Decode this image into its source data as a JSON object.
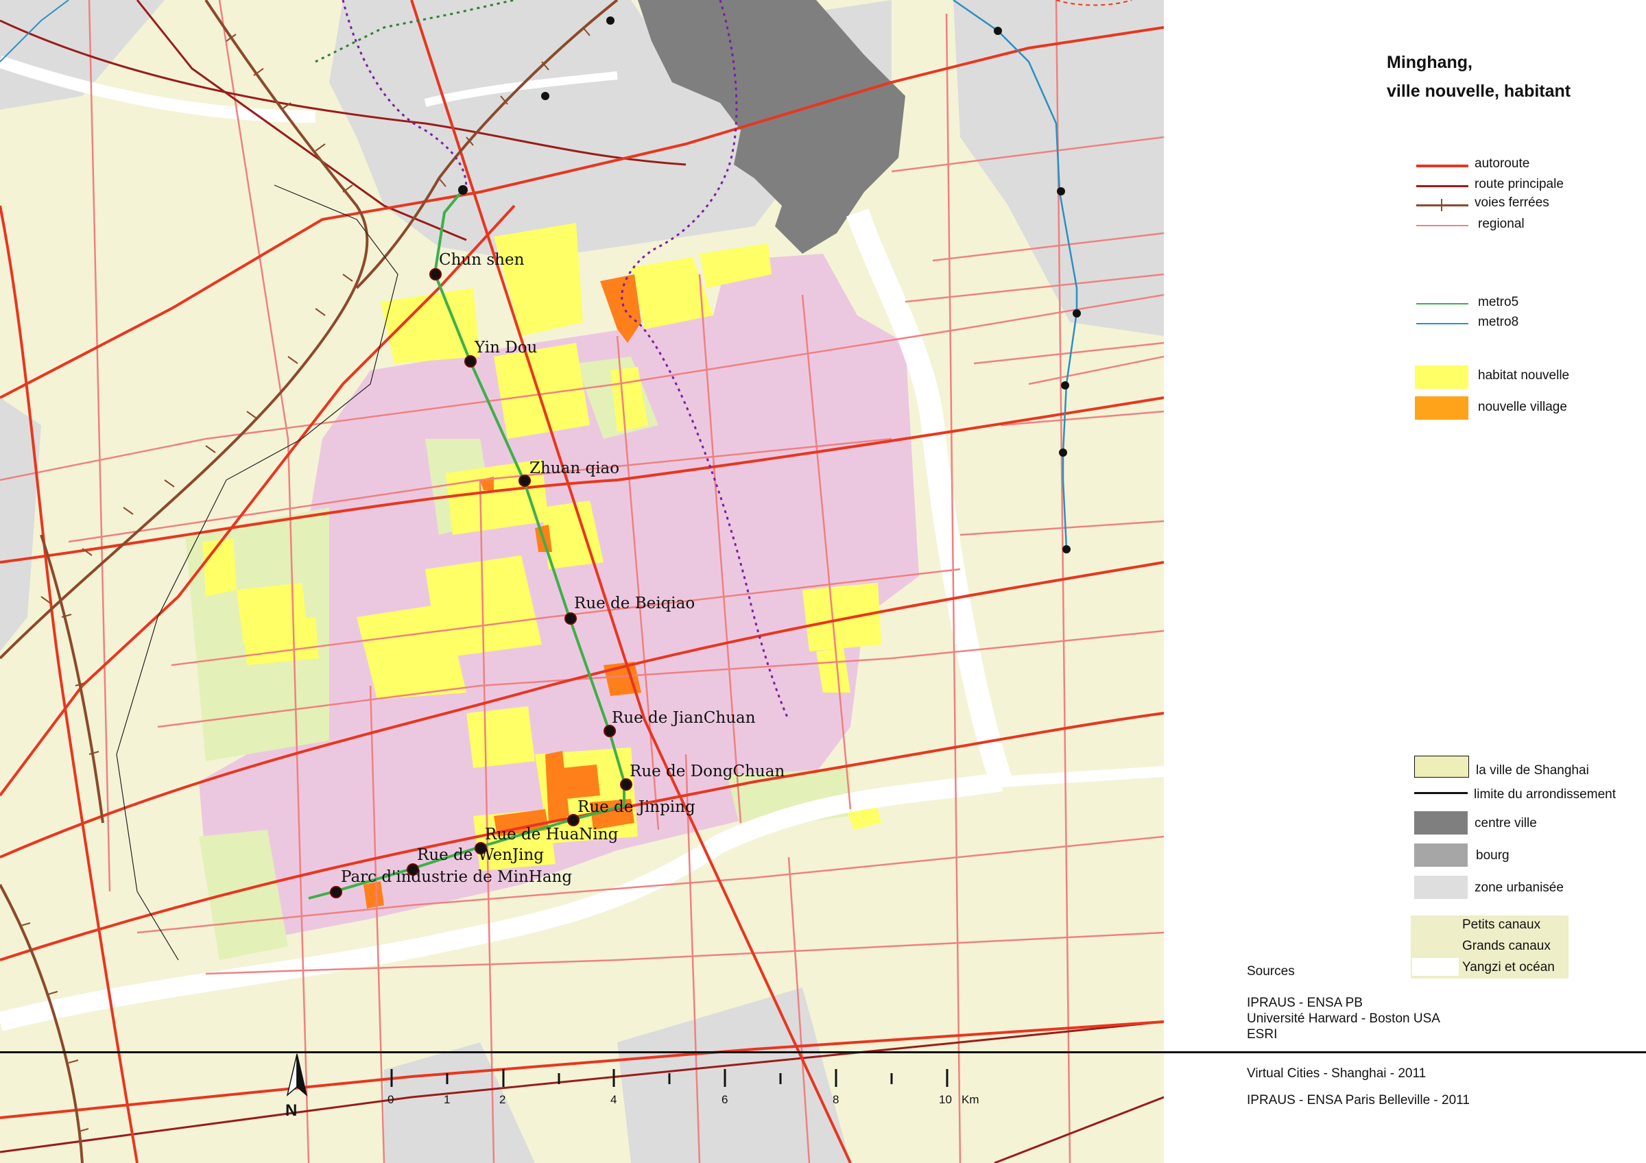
{
  "title": {
    "line1": "Minghang,",
    "line2": "ville nouvelle, habitant"
  },
  "legend_lines": [
    {
      "label": "autoroute",
      "color": "#e8361f"
    },
    {
      "label": "route principale",
      "color": "#9b1b1b"
    },
    {
      "label": "voies ferrées",
      "color": "#8b4a2b"
    },
    {
      "label": "regional",
      "color": "#f08080"
    },
    {
      "label": "metro5",
      "color": "#3cb04a"
    },
    {
      "label": "metro8",
      "color": "#2a8fc4"
    }
  ],
  "legend_fills": [
    {
      "label": "habitat nouvelle",
      "color": "#ffff66"
    },
    {
      "label": "nouvelle village",
      "color": "#ffa31a"
    }
  ],
  "legend_base": [
    {
      "label": "la ville de Shanghai",
      "color": "#eeeeb8"
    },
    {
      "label": "limite du arrondissement",
      "color": "#111111"
    },
    {
      "label": "centre ville",
      "color": "#7f7f7f"
    },
    {
      "label": "bourg",
      "color": "#a6a6a6"
    },
    {
      "label": "zone urbanisée",
      "color": "#dedede"
    }
  ],
  "legend_canals": [
    {
      "label": "Petits canaux",
      "color": "#eeeec8"
    },
    {
      "label": "Grands canaux",
      "color": "#eeeec8"
    },
    {
      "label": "Yangzi et océan",
      "color": "#ffffff"
    }
  ],
  "sources": {
    "heading": "Sources",
    "lines": [
      "IPRAUS - ENSA PB",
      "Université Harward - Boston USA",
      "ESRI"
    ],
    "credit1": "Virtual Cities - Shanghai - 2011",
    "credit2": "IPRAUS - ENSA Paris Belleville - 2011"
  },
  "stations": [
    "Chun shen",
    "Yin Dou",
    "Zhuan qiao",
    "Rue de Beiqiao",
    "Rue de JianChuan",
    "Rue de DongChuan",
    "Rue de Jinping",
    "Rue de HuaNing",
    "Rue de WenJing",
    "Parc d'industrie de MinHang"
  ],
  "scale": {
    "ticks": [
      "0",
      "1",
      "2",
      "4",
      "6",
      "8",
      "10"
    ],
    "unit": "Km"
  },
  "north": "N"
}
